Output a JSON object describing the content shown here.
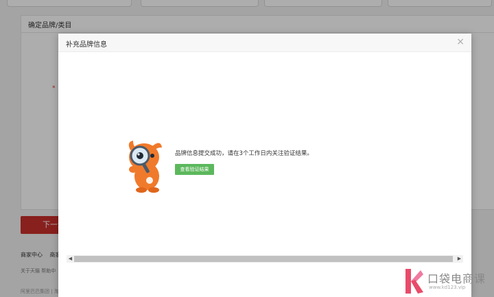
{
  "page": {
    "section_title": "确定品牌/类目",
    "required_mark": "*",
    "next_button_label": "下一步",
    "footer_links": [
      "商家中心",
      "商家"
    ],
    "footer_about": "关于天猫  帮助中",
    "footer_company": "阿里巴巴集团 | 淘"
  },
  "modal": {
    "title": "补充品牌信息",
    "close_symbol": "×",
    "success_message": "品牌信息提交成功，请在3个工作日内关注验证结果。",
    "check_button_label": "查看验证结果",
    "scroll_left": "◀",
    "scroll_right": "▶"
  },
  "watermark": {
    "name": "口袋电商课",
    "url": "www.kd123.vip"
  },
  "colors": {
    "accent_red": "#c9302c",
    "button_green": "#5cb85c",
    "mascot_orange": "#f07a2b"
  }
}
